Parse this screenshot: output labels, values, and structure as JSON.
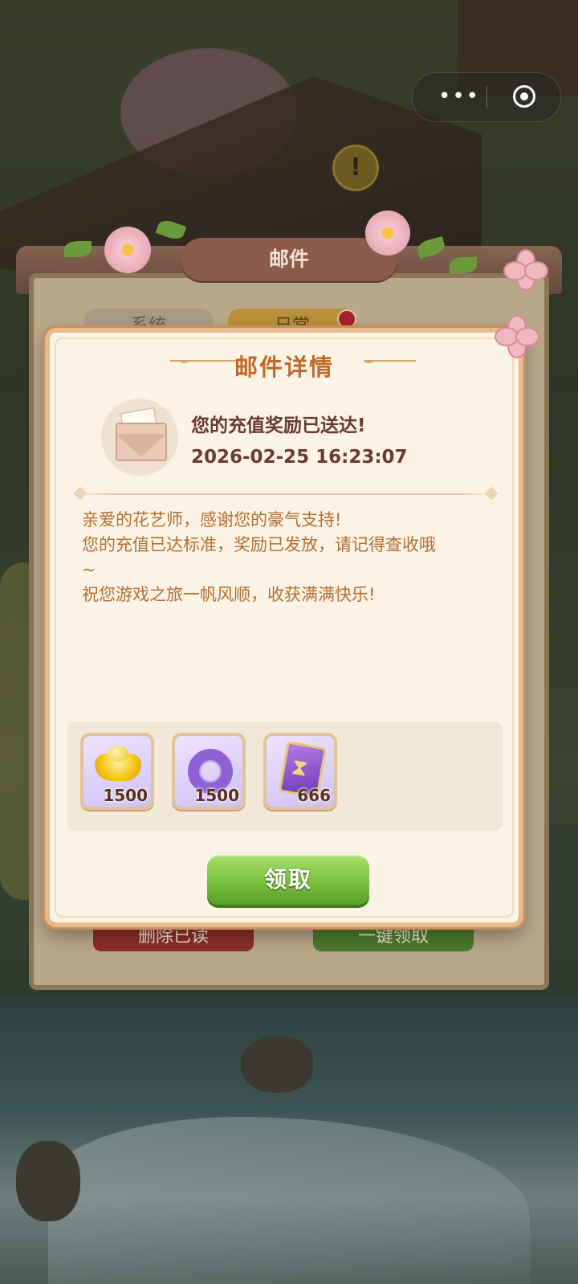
{
  "capsule": {
    "menu_icon": "more-dots-icon",
    "close_icon": "target-circle-icon"
  },
  "back_window": {
    "title": "邮件",
    "tabs": [
      {
        "label": "系统"
      },
      {
        "label": "日常",
        "has_red_dot": true
      }
    ],
    "buttons": [
      {
        "label": "删除已读"
      },
      {
        "label": "一键领取"
      }
    ]
  },
  "detail": {
    "title": "邮件详情",
    "subject": "您的充值奖励已送达!",
    "time": "2026-02-25 16:23:07",
    "body": [
      "亲爱的花艺师，感谢您的豪气支持!",
      "您的充值已达标准，奖励已发放，请记得查收哦",
      "~",
      "祝您游戏之旅一帆风顺，收获满满快乐!"
    ],
    "rewards": [
      {
        "icon": "gold-ingot-icon",
        "count": "1500"
      },
      {
        "icon": "purple-ring-icon",
        "count": "1500"
      },
      {
        "icon": "hourglass-card-icon",
        "count": "666"
      }
    ],
    "claim_label": "领取"
  },
  "colors": {
    "title": "#c06a2a",
    "subject": "#6a3a2e",
    "body": "#b46d32",
    "claim_button": "#79c040",
    "dialog_bg": "#fbf4e6"
  }
}
